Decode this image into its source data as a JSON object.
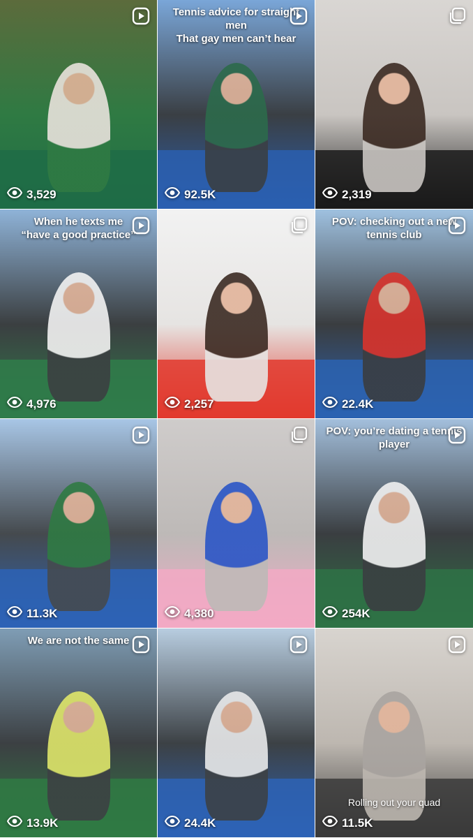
{
  "grid": {
    "tiles": [
      {
        "views": "3,529",
        "caption": "",
        "type": "reel",
        "type_icon": "play-icon",
        "palette": [
          "#5c6b3c",
          "#2f7a43",
          "#1f6c46",
          "#e9e2dc"
        ]
      },
      {
        "views": "92.5K",
        "caption": "Tennis advice for straight men\nThat gay men can’t hear",
        "type": "reel",
        "type_icon": "play-icon",
        "palette": [
          "#7aa6d8",
          "#3a3f44",
          "#2a5fb0",
          "#2c6a4b"
        ]
      },
      {
        "views": "2,319",
        "caption": "",
        "type": "carousel",
        "type_icon": "carousel-icon",
        "palette": [
          "#d9d6d3",
          "#c9c5c1",
          "#1a1a1a",
          "#3b2a22"
        ]
      },
      {
        "views": "4,976",
        "caption": "When he texts me\n“have a good practice”",
        "type": "reel",
        "type_icon": "play-icon",
        "palette": [
          "#8fb3d8",
          "#3b3f41",
          "#2f7c4a",
          "#f2f2f2"
        ]
      },
      {
        "views": "2,257",
        "caption": "",
        "type": "carousel",
        "type_icon": "carousel-icon",
        "palette": [
          "#f2f2f2",
          "#e6e4e2",
          "#e23a2e",
          "#3b2a22"
        ]
      },
      {
        "views": "22.4K",
        "caption": "POV: checking out a new\ntennis club",
        "type": "reel",
        "type_icon": "play-icon",
        "palette": [
          "#9fc1e0",
          "#3a3d40",
          "#2b63b2",
          "#d9332c"
        ]
      },
      {
        "views": "11.3K",
        "caption": "",
        "type": "reel",
        "type_icon": "play-icon",
        "palette": [
          "#a8c6e6",
          "#454a4e",
          "#2d63b6",
          "#2f7a43"
        ]
      },
      {
        "views": "4,380",
        "caption": "",
        "type": "carousel",
        "type_icon": "carousel-icon",
        "palette": [
          "#cfcccb",
          "#bdb9b7",
          "#f2a9c4",
          "#2a55c6"
        ]
      },
      {
        "views": "254K",
        "caption": "POV: you’re dating a tennis player",
        "type": "reel",
        "type_icon": "play-icon",
        "palette": [
          "#a3bfdc",
          "#3a3e41",
          "#2e7245",
          "#f1f1f1"
        ]
      },
      {
        "views": "13.9K",
        "caption": "We are not the same",
        "type": "reel",
        "type_icon": "play-icon",
        "palette": [
          "#7f9db5",
          "#3c4043",
          "#2f7a43",
          "#dfe66a"
        ]
      },
      {
        "views": "24.4K",
        "caption": "",
        "type": "reel",
        "type_icon": "play-icon",
        "palette": [
          "#b8cde0",
          "#3c4145",
          "#2d63b6",
          "#e8e9ea"
        ]
      },
      {
        "views": "11.5K",
        "caption": "Rolling out your quad",
        "type": "reel",
        "type_icon": "play-icon",
        "palette": [
          "#d8d4cf",
          "#bdb7b0",
          "#3a3a3a",
          "#a9a4a0"
        ]
      }
    ]
  }
}
